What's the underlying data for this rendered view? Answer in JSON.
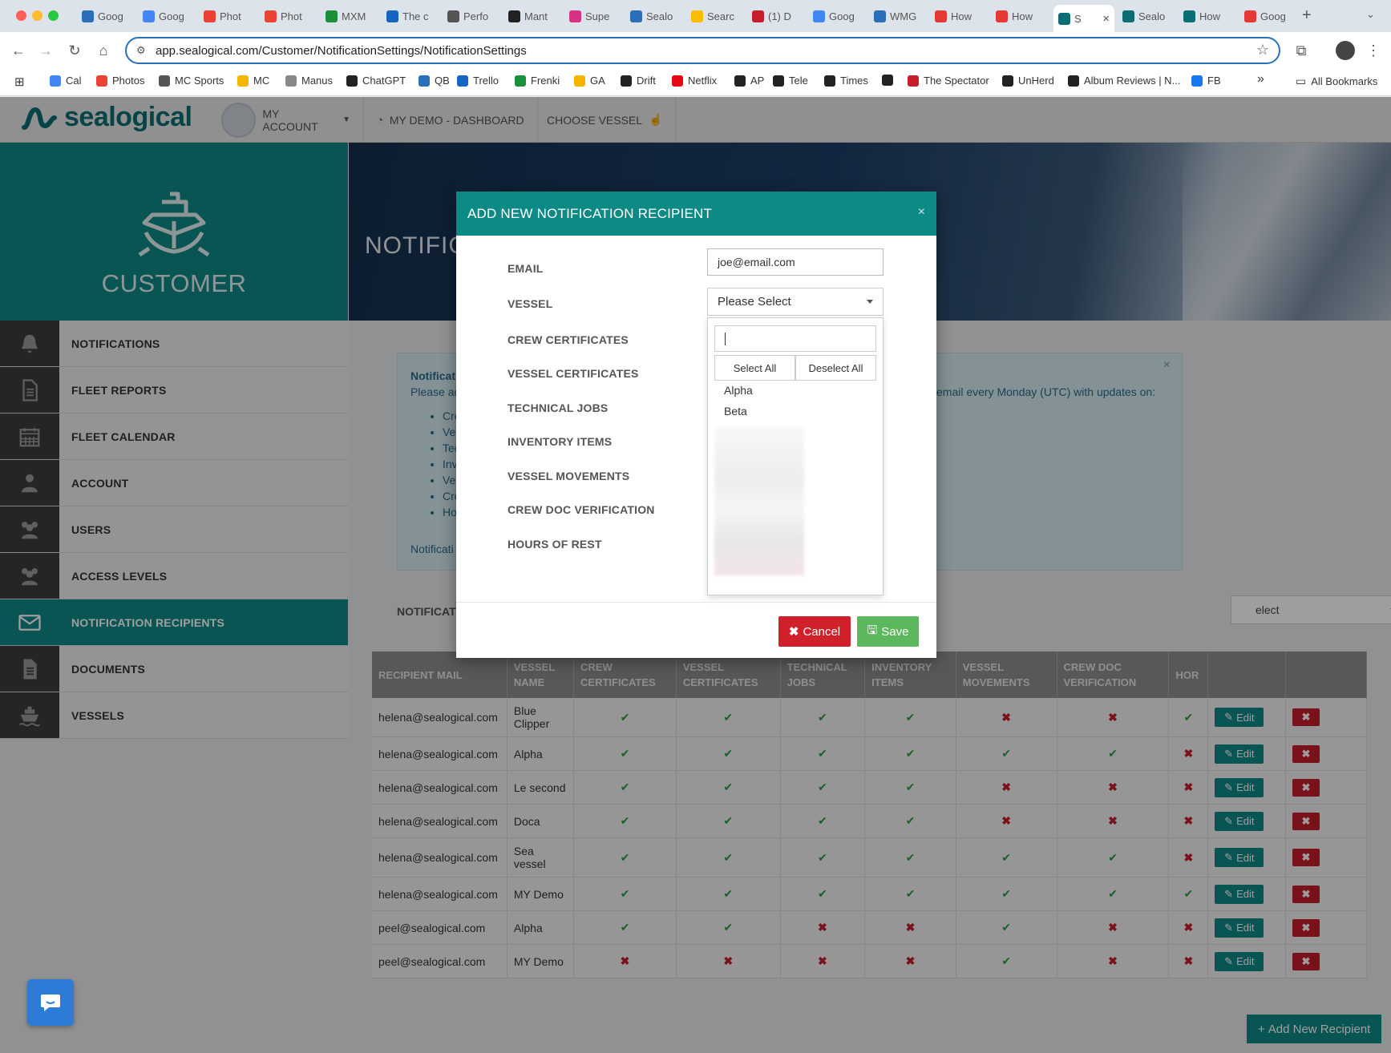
{
  "browser": {
    "tabs": [
      {
        "label": "Goog",
        "color": "#2a6fb8"
      },
      {
        "label": "Goog",
        "color": "#4285f4"
      },
      {
        "label": "Phot",
        "color": "#ea4335"
      },
      {
        "label": "Phot",
        "color": "#ea4335"
      },
      {
        "label": "MXM",
        "color": "#1a8f3c"
      },
      {
        "label": "The c",
        "color": "#1565c0"
      },
      {
        "label": "Perfo",
        "color": "#555555"
      },
      {
        "label": "Mant",
        "color": "#222222"
      },
      {
        "label": "Supe",
        "color": "#d63384"
      },
      {
        "label": "Sealo",
        "color": "#2a6fb8"
      },
      {
        "label": "Searc",
        "color": "#fbbc04"
      },
      {
        "label": "(1) D",
        "color": "#c61e2c"
      },
      {
        "label": "Goog",
        "color": "#4285f4"
      },
      {
        "label": "WMG",
        "color": "#2a6fb8"
      },
      {
        "label": "How",
        "color": "#e53935"
      },
      {
        "label": "How",
        "color": "#e53935"
      },
      {
        "label": "S",
        "color": "#0b6e74",
        "active": true
      },
      {
        "label": "Sealo",
        "color": "#0b6e74"
      },
      {
        "label": "How",
        "color": "#0b6e74"
      },
      {
        "label": "Goog",
        "color": "#e53935"
      }
    ],
    "url": "app.sealogical.com/Customer/NotificationSettings/NotificationSettings",
    "bookmarks": [
      {
        "label": "Cal",
        "color": "#4285f4"
      },
      {
        "label": "Photos",
        "color": "#ea4335"
      },
      {
        "label": "MC Sports",
        "color": "#555555"
      },
      {
        "label": "MC",
        "color": "#f4b400"
      },
      {
        "label": "Manus",
        "color": "#888888"
      },
      {
        "label": "ChatGPT",
        "color": "#222222"
      },
      {
        "label": "QB",
        "color": "#2a6fb8"
      },
      {
        "label": "Trello",
        "color": "#1565c0"
      },
      {
        "label": "Frenki",
        "color": "#1a8f3c"
      },
      {
        "label": "GA",
        "color": "#f4b400"
      },
      {
        "label": "Drift",
        "color": "#222222"
      },
      {
        "label": "Netflix",
        "color": "#e50914"
      },
      {
        "label": "AP",
        "color": "#222222"
      },
      {
        "label": "Tele",
        "color": "#222222"
      },
      {
        "label": "Times",
        "color": "#222222"
      },
      {
        "label": "",
        "color": "#222222"
      },
      {
        "label": "The Spectator",
        "color": "#c61e2c"
      },
      {
        "label": "UnHerd",
        "color": "#222222"
      },
      {
        "label": "Album Reviews | N...",
        "color": "#222222"
      },
      {
        "label": "FB",
        "color": "#1877f2"
      }
    ],
    "bookmarks_more": "»",
    "all_bookmarks": "All Bookmarks"
  },
  "header": {
    "logo": "sealogical",
    "my_account": "MY ACCOUNT",
    "dashboard": "MY DEMO - DASHBOARD",
    "choose_vessel": "CHOOSE VESSEL"
  },
  "sidebar": {
    "title": "CUSTOMER",
    "items": [
      {
        "label": "NOTIFICATIONS",
        "icon": "bell-icon"
      },
      {
        "label": "FLEET REPORTS",
        "icon": "document-icon"
      },
      {
        "label": "FLEET CALENDAR",
        "icon": "calendar-icon"
      },
      {
        "label": "ACCOUNT",
        "icon": "user-icon"
      },
      {
        "label": "USERS",
        "icon": "users-icon"
      },
      {
        "label": "ACCESS LEVELS",
        "icon": "users-icon"
      },
      {
        "label": "NOTIFICATION RECIPIENTS",
        "icon": "envelope-icon",
        "active": true
      },
      {
        "label": "DOCUMENTS",
        "icon": "file-icon"
      },
      {
        "label": "VESSELS",
        "icon": "ship-icon"
      }
    ]
  },
  "page": {
    "banner_title": "NOTIFIC",
    "info_title": "Notificat",
    "info_text_left": "Please ad",
    "info_text_right": "email every Monday (UTC) with updates on:",
    "info_list": [
      "Cre",
      "Ves",
      "Tec",
      "Inv",
      "Ves",
      "Cre",
      "Ho"
    ],
    "info_footer": "Notificati",
    "filter_label": "NOTIFICAT",
    "filter_select": "elect"
  },
  "table": {
    "headers": [
      "RECIPIENT MAIL",
      "VESSEL NAME",
      "CREW CERTIFICATES",
      "VESSEL CERTIFICATES",
      "TECHNICAL JOBS",
      "INVENTORY ITEMS",
      "VESSEL MOVEMENTS",
      "CREW DOC VERIFICATION",
      "HOR",
      "",
      ""
    ],
    "edit_label": "Edit",
    "rows": [
      {
        "mail": "helena@sealogical.com",
        "vessel": "Blue Clipper",
        "flags": [
          true,
          true,
          true,
          true,
          false,
          false,
          true
        ]
      },
      {
        "mail": "helena@sealogical.com",
        "vessel": "Alpha",
        "flags": [
          true,
          true,
          true,
          true,
          true,
          true,
          false
        ]
      },
      {
        "mail": "helena@sealogical.com",
        "vessel": "Le second",
        "flags": [
          true,
          true,
          true,
          true,
          false,
          false,
          false
        ]
      },
      {
        "mail": "helena@sealogical.com",
        "vessel": "Doca",
        "flags": [
          true,
          true,
          true,
          true,
          false,
          false,
          false
        ]
      },
      {
        "mail": "helena@sealogical.com",
        "vessel": "Sea vessel",
        "flags": [
          true,
          true,
          true,
          true,
          true,
          true,
          false
        ]
      },
      {
        "mail": "helena@sealogical.com",
        "vessel": "MY Demo",
        "flags": [
          true,
          true,
          true,
          true,
          true,
          true,
          true
        ]
      },
      {
        "mail": "peel@sealogical.com",
        "vessel": "Alpha",
        "flags": [
          true,
          true,
          false,
          false,
          true,
          false,
          false
        ]
      },
      {
        "mail": "peel@sealogical.com",
        "vessel": "MY Demo",
        "flags": [
          false,
          false,
          false,
          false,
          true,
          false,
          false
        ]
      }
    ]
  },
  "add_button": "Add New Recipient",
  "modal": {
    "title": "ADD NEW NOTIFICATION RECIPIENT",
    "close": "×",
    "fields": [
      "EMAIL",
      "VESSEL",
      "CREW CERTIFICATES",
      "VESSEL CERTIFICATES",
      "TECHNICAL JOBS",
      "INVENTORY ITEMS",
      "VESSEL MOVEMENTS",
      "CREW DOC VERIFICATION",
      "HOURS OF REST"
    ],
    "email_value": "joe@email.com",
    "vessel_placeholder": "Please Select",
    "dropdown": {
      "select_all": "Select All",
      "deselect_all": "Deselect All",
      "options": [
        "Alpha",
        "Beta"
      ]
    },
    "cancel": "Cancel",
    "save": "Save"
  },
  "colors": {
    "teal": "#0e8a86",
    "danger": "#d0202a",
    "success": "#5cb85c"
  }
}
